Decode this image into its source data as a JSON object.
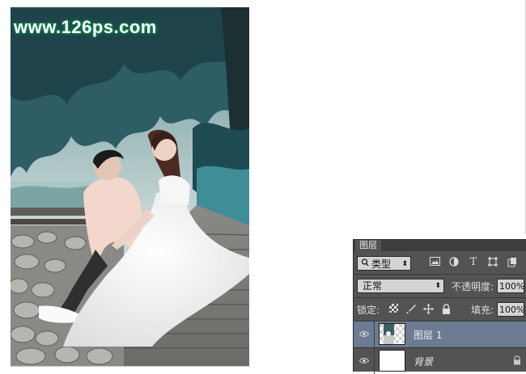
{
  "canvas": {
    "watermark": "www.126ps.com"
  },
  "layers_panel": {
    "tab_label": "图层",
    "filter": {
      "search_icon": "search-icon",
      "kind_label": "类型",
      "filter_icons": [
        "image-filter-icon",
        "adjustment-filter-icon",
        "type-filter-icon",
        "shape-filter-icon",
        "smart-object-filter-icon"
      ],
      "type_glyph": "T"
    },
    "blend_mode": "正常",
    "opacity_label": "不透明度:",
    "opacity_value": "100%",
    "lock_label": "锁定:",
    "lock_icons": [
      "lock-transparent-icon",
      "lock-pixels-icon",
      "lock-position-icon",
      "lock-all-icon"
    ],
    "fill_label": "填充:",
    "fill_value": "100%",
    "layers": [
      {
        "name": "图层 1",
        "selected": true,
        "visible": true,
        "locked": false
      },
      {
        "name": "背景",
        "selected": false,
        "visible": true,
        "locked": true
      }
    ],
    "colors": {
      "panel_bg": "#535353",
      "selected_row": "#6c7b91"
    }
  }
}
